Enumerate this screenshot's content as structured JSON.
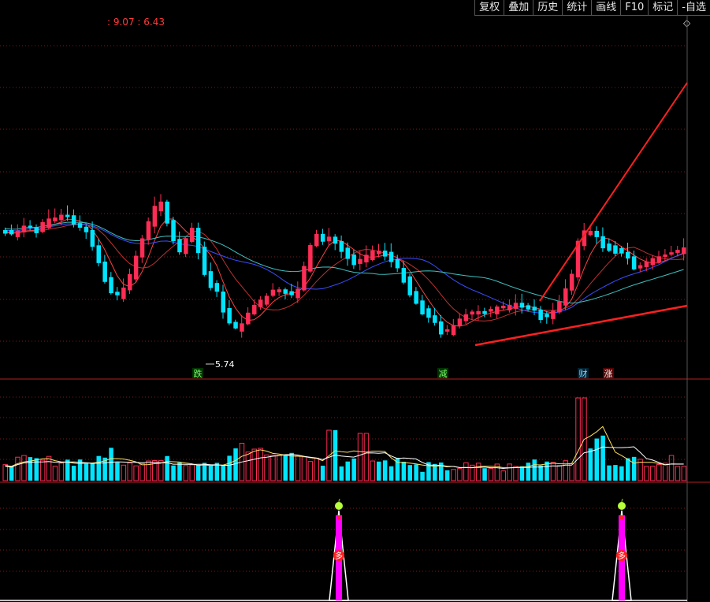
{
  "toolbar": {
    "buttons": [
      "复权",
      "叠加",
      "历史",
      "统计",
      "画线",
      "F10",
      "标记",
      "-自选"
    ]
  },
  "price_range": ": 9.07 : 6.43",
  "annotations": {
    "low_price": "5.74",
    "markers": [
      "跌",
      "减",
      "财",
      "涨"
    ]
  },
  "indicator": {
    "signal_label": "多",
    "signal_icon": "apple-icon"
  },
  "colors": {
    "up": "#ff2d55",
    "down": "#00e5ff",
    "grid": "#7a1a1a",
    "trend": "#ff2020",
    "ma_short": "#ff4040",
    "ma_mid": "#3a4dff",
    "ma_long": "#40c0c0",
    "vol_ma": "#ffe060",
    "signal": "#ff00ff"
  }
}
